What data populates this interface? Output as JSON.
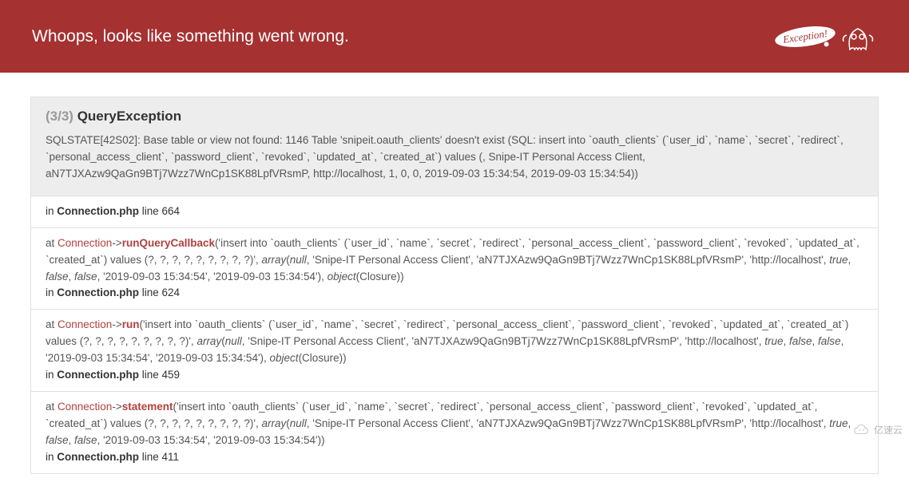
{
  "header": {
    "title": "Whoops, looks like something went wrong.",
    "bubble": "Exception!"
  },
  "exception": {
    "count": "(3/3)",
    "name": "QueryException",
    "message": "SQLSTATE[42S02]: Base table or view not found: 1146 Table 'snipeit.oauth_clients' doesn't exist (SQL: insert into `oauth_clients` (`user_id`, `name`, `secret`, `redirect`, `personal_access_client`, `password_client`, `revoked`, `updated_at`, `created_at`) values (, Snipe-IT Personal Access Client, aN7TJXAzw9QaGn9BTj7Wzz7WnCp1SK88LpfVRsmP, http://localhost, 1, 0, 0, 2019-09-03 15:34:54, 2019-09-03 15:34:54))"
  },
  "frames": [
    {
      "in_file": "Connection.php",
      "in_line": "line 664"
    },
    {
      "at_class": "Connection",
      "at_method": "runQueryCallback",
      "args_pre": "('insert into `oauth_clients` (`user_id`, `name`, `secret`, `redirect`, `personal_access_client`, `password_client`, `revoked`, `updated_at`, `created_at`) values (?, ?, ?, ?, ?, ?, ?, ?, ?)', ",
      "array_kw": "array",
      "array_body": "(",
      "null_kw": "null",
      "args_mid1": ", 'Snipe-IT Personal Access Client', 'aN7TJXAzw9QaGn9BTj7Wzz7WnCp1SK88LpfVRsmP', 'http://localhost', ",
      "true_kw": "true",
      "false_kw": "false",
      "args_mid2": ", '2019-09-03 15:34:54', '2019-09-03 15:34:54'), ",
      "obj_kw": "object",
      "args_tail": "(Closure))",
      "in_file": "Connection.php",
      "in_line": "line 624"
    },
    {
      "at_class": "Connection",
      "at_method": "run",
      "args_pre": "('insert into `oauth_clients` (`user_id`, `name`, `secret`, `redirect`, `personal_access_client`, `password_client`, `revoked`, `updated_at`, `created_at`) values (?, ?, ?, ?, ?, ?, ?, ?, ?)', ",
      "array_kw": "array",
      "array_body": "(",
      "null_kw": "null",
      "args_mid1": ", 'Snipe-IT Personal Access Client', 'aN7TJXAzw9QaGn9BTj7Wzz7WnCp1SK88LpfVRsmP', 'http://localhost', ",
      "true_kw": "true",
      "false_kw": "false",
      "args_mid2": ", '2019-09-03 15:34:54', '2019-09-03 15:34:54'), ",
      "obj_kw": "object",
      "args_tail": "(Closure))",
      "in_file": "Connection.php",
      "in_line": "line 459"
    },
    {
      "at_class": "Connection",
      "at_method": "statement",
      "args_pre": "('insert into `oauth_clients` (`user_id`, `name`, `secret`, `redirect`, `personal_access_client`, `password_client`, `revoked`, `updated_at`, `created_at`) values (?, ?, ?, ?, ?, ?, ?, ?, ?)', ",
      "array_kw": "array",
      "array_body": "(",
      "null_kw": "null",
      "args_mid1": ", 'Snipe-IT Personal Access Client', 'aN7TJXAzw9QaGn9BTj7Wzz7WnCp1SK88LpfVRsmP', 'http://localhost', ",
      "true_kw": "true",
      "false_kw": "false",
      "args_mid2": ", '2019-09-03 15:34:54', '2019-09-03 15:34:54'))",
      "obj_kw": "",
      "args_tail": "",
      "in_file": "Connection.php",
      "in_line": "line 411"
    }
  ],
  "watermark": "亿速云"
}
